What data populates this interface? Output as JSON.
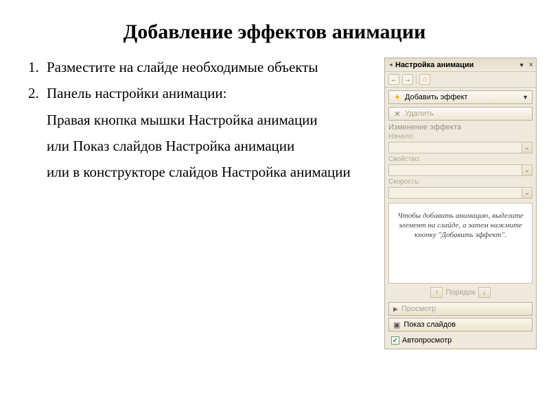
{
  "slide": {
    "title": "Добавление эффектов анимации",
    "list": {
      "item1": "Разместите на слайде необходимые объекты",
      "item2": "Панель настройки анимации:",
      "p1": "Правая кнопка мышки Настройка анимации",
      "p2": "или Показ слайдов Настройка анимации",
      "p3": "или в конструкторе слайдов Настройка анимации"
    }
  },
  "pane": {
    "title": "Настройка анимации",
    "add_effect": "Добавить эффект",
    "remove": "Удалить",
    "section_modify": "Изменение эффекта",
    "field_start": "Начало:",
    "field_property": "Свойство:",
    "field_speed": "Скорость:",
    "hint": "Чтобы добавить анимацию, выделите элемент на слайде, а затем нажмите кнопку \"Добавить эффект\".",
    "reorder": "Порядок",
    "preview": "Просмотр",
    "slideshow": "Показ слайдов",
    "autopreview": "Автопросмотр"
  }
}
